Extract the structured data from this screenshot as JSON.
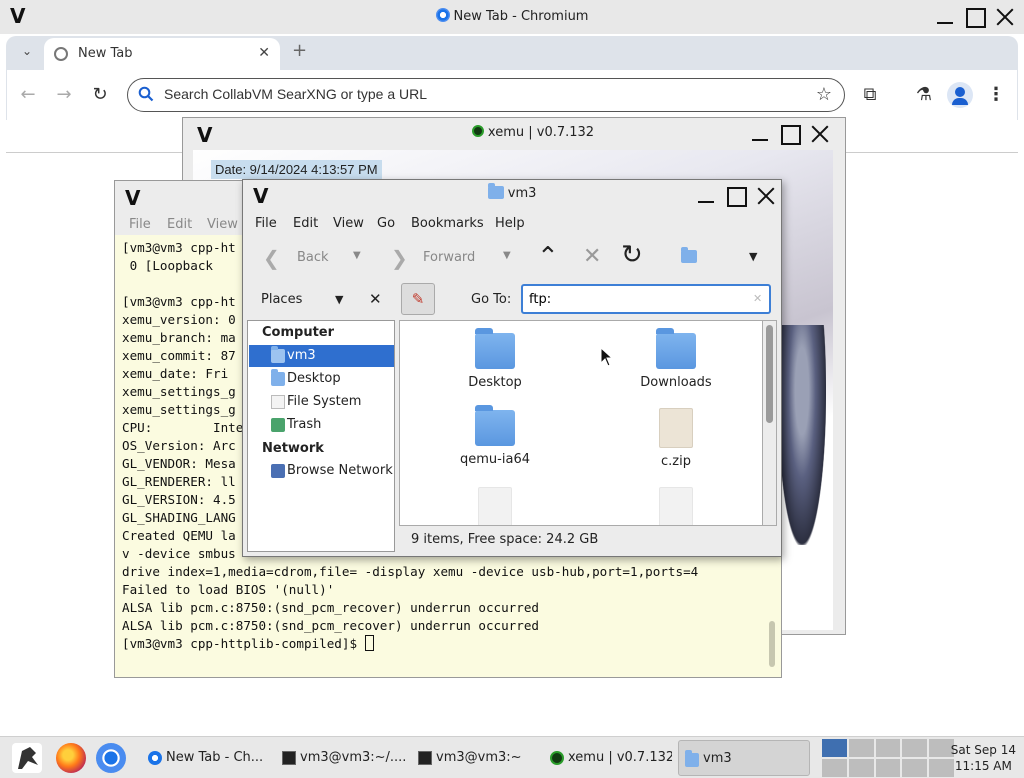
{
  "chrome": {
    "window_title": "New Tab - Chromium",
    "tab_label": "New Tab",
    "omnibox_placeholder": "Search CollabVM SearXNG or type a URL"
  },
  "xemu": {
    "title": "xemu | v0.7.132",
    "overlay_date": "Date: 9/14/2024 4:13:57 PM"
  },
  "terminal": {
    "menu": [
      "File",
      "Edit",
      "View"
    ],
    "lines": [
      "[vm3@vm3 cpp-ht",
      " 0 [Loopback",
      "",
      "[vm3@vm3 cpp-ht",
      "xemu_version: 0",
      "xemu_branch: ma",
      "xemu_commit: 87",
      "xemu_date: Fri",
      "xemu_settings_g",
      "xemu_settings_g",
      "CPU:        Inte",
      "OS_Version: Arc",
      "GL_VENDOR: Mesa",
      "GL_RENDERER: ll",
      "GL_VERSION: 4.5",
      "GL_SHADING_LANG",
      "Created QEMU la",
      "v -device smbus",
      "drive index=1,media=cdrom,file= -display xemu -device usb-hub,port=1,ports=4",
      "Failed to load BIOS '(null)'",
      "ALSA lib pcm.c:8750:(snd_pcm_recover) underrun occurred",
      "ALSA lib pcm.c:8750:(snd_pcm_recover) underrun occurred"
    ],
    "prompt": "[vm3@vm3 cpp-httplib-compiled]$ "
  },
  "filemanager": {
    "title": "vm3",
    "menu": [
      "File",
      "Edit",
      "View",
      "Go",
      "Bookmarks",
      "Help"
    ],
    "back_label": "Back",
    "forward_label": "Forward",
    "places_label": "Places",
    "goto_label": "Go To:",
    "goto_value": "ftp:",
    "sidebar": {
      "computer_header": "Computer",
      "network_header": "Network",
      "items": [
        "vm3",
        "Desktop",
        "File System",
        "Trash",
        "Browse Network"
      ]
    },
    "files": [
      "Desktop",
      "Downloads",
      "qemu-ia64",
      "c.zip"
    ],
    "status": "9 items, Free space: 24.2 GB"
  },
  "taskbar": {
    "tasks": [
      "New Tab - Ch...",
      "vm3@vm3:~/....",
      "vm3@vm3:~",
      "xemu | v0.7.132",
      "vm3"
    ],
    "clock_day": "Sat Sep 14",
    "clock_time": "11:15 AM"
  },
  "colors": {
    "selection": "#2f6fcf",
    "folder": "#7fb0ea",
    "terminal_bg": "#fbfbe0"
  }
}
